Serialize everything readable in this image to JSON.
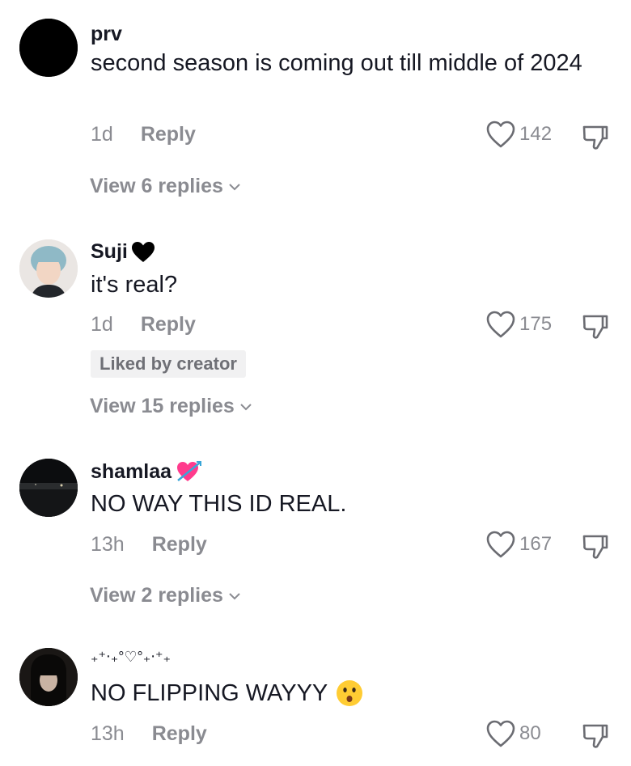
{
  "comments": [
    {
      "username": "prv",
      "text": "second season is coming out till middle of 2024",
      "time": "1d",
      "reply_label": "Reply",
      "likes": "142",
      "view_replies": "View 6 replies"
    },
    {
      "username": "Suji",
      "username_icon": "black-heart-icon",
      "text": "it's real?",
      "time": "1d",
      "reply_label": "Reply",
      "likes": "175",
      "badge": "Liked by creator",
      "view_replies": "View 15 replies"
    },
    {
      "username": "shamlaa",
      "username_icon": "heart-with-arrow-icon",
      "text": "NO WAY THIS ID REAL.",
      "time": "13h",
      "reply_label": "Reply",
      "likes": "167",
      "view_replies": "View 2 replies"
    },
    {
      "username": "₊⁺‧₊°♡°₊‧⁺₊",
      "text": "NO FLIPPING WAYYY",
      "text_emoji": "hushed-face-emoji",
      "time": "13h",
      "reply_label": "Reply",
      "likes": "80"
    }
  ],
  "colors": {
    "primary_text": "#161823",
    "secondary_text": "#8a8b91",
    "badge_bg": "#f1f1f2",
    "shamlaa_heart": "#ff3b8d"
  }
}
